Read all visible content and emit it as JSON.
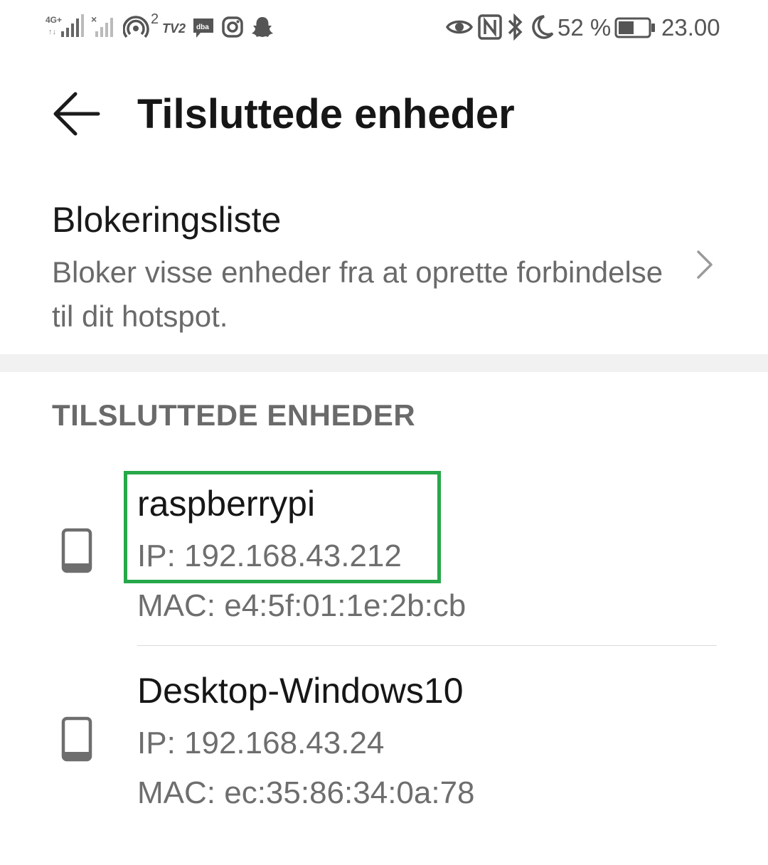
{
  "status_bar": {
    "network_label": "4G+",
    "hotspot_count": "2",
    "battery_percent": "52 %",
    "battery_level": 0.52,
    "time": "23.00",
    "app_icons": [
      "tv2-icon",
      "dba-icon",
      "messenger-icon",
      "instagram-icon",
      "snapchat-icon"
    ],
    "right_icons": [
      "eye-icon",
      "nfc-icon",
      "bluetooth-icon",
      "moon-icon",
      "battery-icon"
    ]
  },
  "header": {
    "title": "Tilsluttede enheder",
    "back_icon": "arrow-left-icon"
  },
  "blocklist": {
    "title": "Blokeringsliste",
    "description": "Bloker visse enheder fra at oprette forbindelse til dit hotspot.",
    "chevron_icon": "chevron-right-icon"
  },
  "section": {
    "header": "TILSLUTTEDE ENHEDER"
  },
  "devices": [
    {
      "name": "raspberrypi",
      "ip": "IP: 192.168.43.212",
      "mac": "MAC: e4:5f:01:1e:2b:cb",
      "icon": "phone-icon",
      "highlighted": true
    },
    {
      "name": "Desktop-Windows10",
      "ip": "IP: 192.168.43.24",
      "mac": "MAC: ec:35:86:34:0a:78",
      "icon": "phone-icon",
      "highlighted": false
    }
  ],
  "colors": {
    "highlight": "#27a84a",
    "primary_text": "#161616",
    "secondary_text": "#6a6a6a",
    "divider": "#f1f1f1"
  }
}
